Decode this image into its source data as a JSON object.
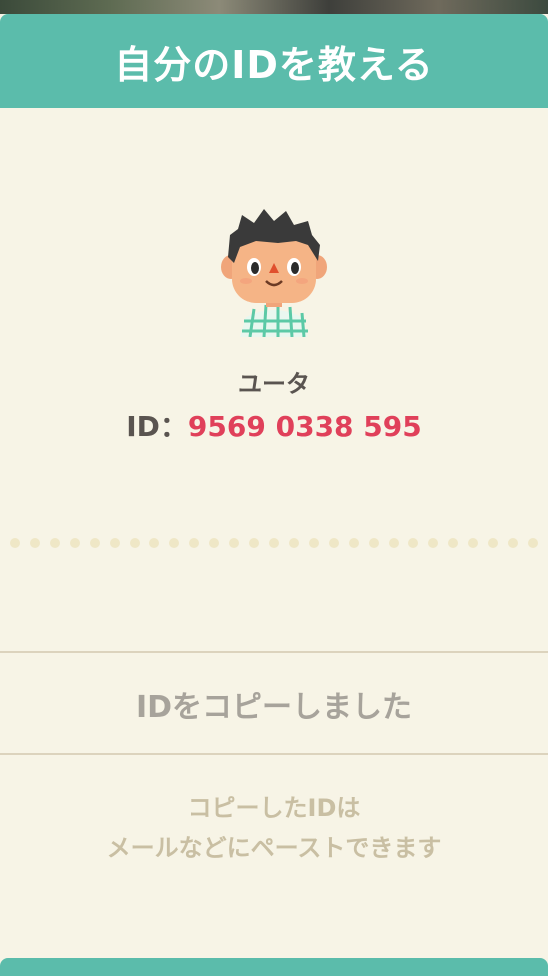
{
  "header": {
    "title": "自分のIDを教える"
  },
  "profile": {
    "name": "ユータ",
    "id_label": "ID：",
    "id_value": "9569 0338 595"
  },
  "status": {
    "copied_message": "IDをコピーしました"
  },
  "hint": {
    "line1": "コピーしたIDは",
    "line2": "メールなどにペーストできます"
  },
  "colors": {
    "accent": "#5bbcab",
    "id_value": "#e0405a",
    "background": "#f7f4e6"
  },
  "icons": {
    "avatar": "villager-avatar-icon"
  }
}
